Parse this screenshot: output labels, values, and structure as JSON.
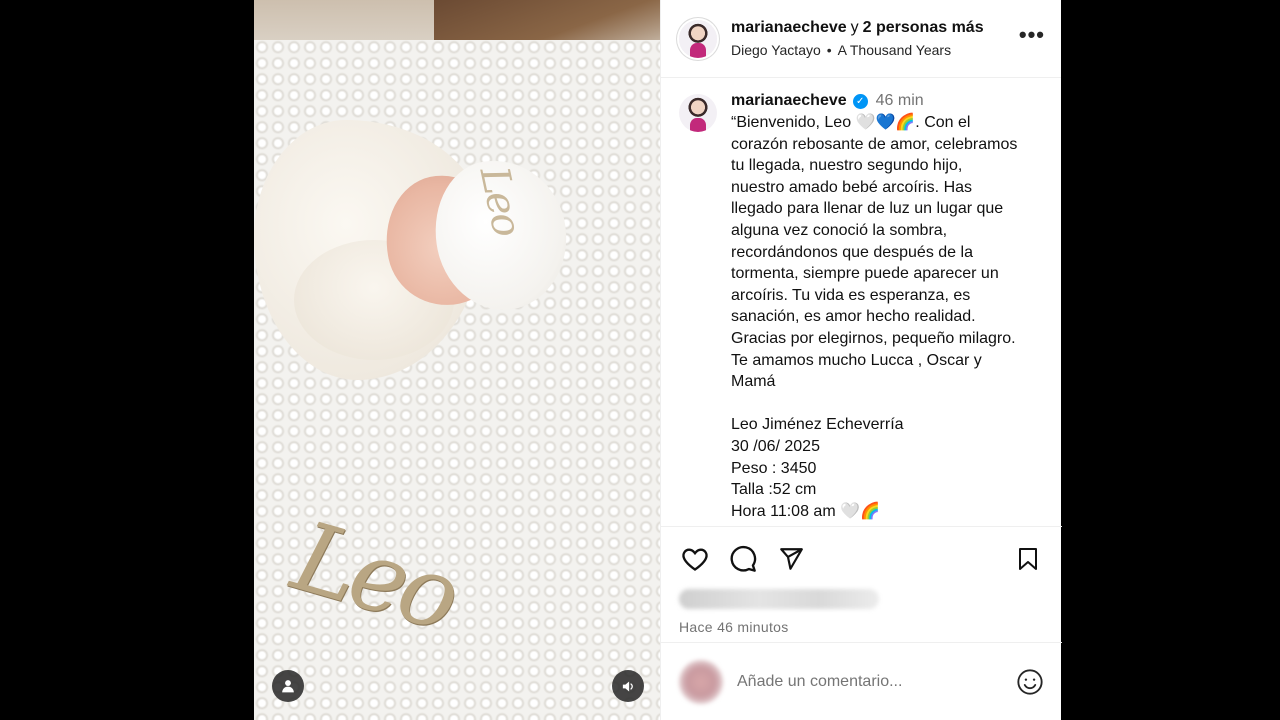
{
  "header": {
    "username": "marianaecheve",
    "connector": "y",
    "others": "2 personas más",
    "audio_artist": "Diego Yactayo",
    "separator": "•",
    "audio_track": "A Thousand Years",
    "more_label": "•••"
  },
  "post": {
    "author": "marianaecheve",
    "verified_mark": "✓",
    "time_ago": "46 min",
    "caption": "“Bienvenido, Leo 🤍💙🌈. Con el\ncorazón rebosante de amor, celebramos\ntu llegada, nuestro segundo hijo,\nnuestro amado bebé arcoíris. Has\nllegado para llenar de luz un lugar que\nalguna vez conoció la sombra,\nrecordándonos que después de la\ntormenta, siempre puede aparecer un\narcoíris. Tu vida es esperanza, es\nsanación, es amor hecho realidad.\nGracias por elegirnos, pequeño milagro.\nTe amamos mucho Lucca , Oscar y\nMamá\n\nLeo Jiménez Echeverría\n30 /06/ 2025\nPeso : 3450\nTalla :52 cm\nHora 11:08 am 🤍🌈"
  },
  "media": {
    "hat_text": "Leo",
    "blanket_text": "Leo"
  },
  "actions": {
    "timestamp": "Hace 46 minutos"
  },
  "comment": {
    "placeholder": "Añade un comentario..."
  },
  "icons": {
    "like": "heart-icon",
    "comment": "comment-icon",
    "share": "share-icon",
    "save": "bookmark-icon",
    "emoji": "emoji-icon",
    "user_tags": "user-icon",
    "audio": "speaker-icon"
  },
  "colors": {
    "verified": "#0095f6",
    "secondary_text": "#737373",
    "divider": "#efefef"
  }
}
